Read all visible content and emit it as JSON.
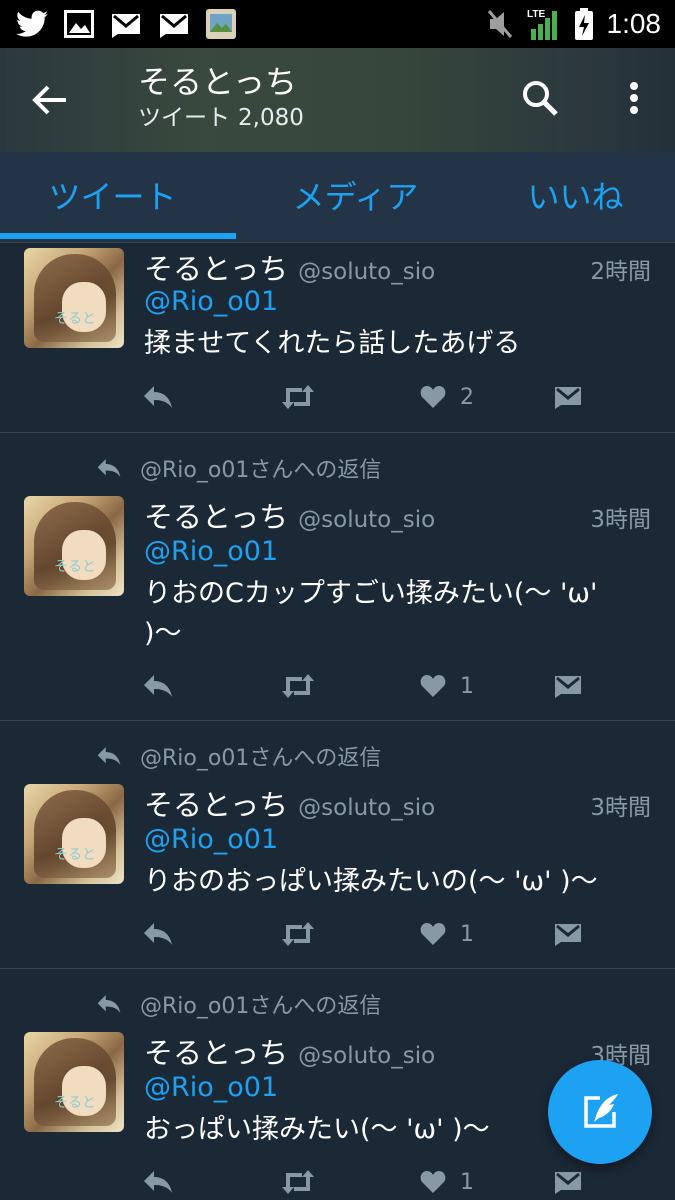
{
  "status_bar": {
    "time": "1:08",
    "network": "LTE",
    "left_icons": [
      "twitter-icon",
      "image-icon",
      "mail-icon",
      "mail-icon",
      "gallery-icon"
    ],
    "right_icons": [
      "mute-icon",
      "signal-icon",
      "battery-charging-icon"
    ]
  },
  "header": {
    "title": "そるとっち",
    "tweet_count_label": "ツイート",
    "tweet_count": "2,080"
  },
  "tabs": [
    {
      "label": "ツイート",
      "active": true
    },
    {
      "label": "メディア",
      "active": false
    },
    {
      "label": "いいね",
      "active": false
    }
  ],
  "tweets": [
    {
      "reply_context": "",
      "name": "そるとっち",
      "handle": "@soluto_sio",
      "time": "2時間",
      "mention": "@Rio_o01",
      "text": "揉ませてくれたら話したあげる",
      "likes": "2"
    },
    {
      "reply_context": "@Rio_o01さんへの返信",
      "name": "そるとっち",
      "handle": "@soluto_sio",
      "time": "3時間",
      "mention": "@Rio_o01",
      "text_line1": "りおのCカップすごい揉みたい(〜 'ω'",
      "text_line2": ")〜",
      "likes": "1"
    },
    {
      "reply_context": "@Rio_o01さんへの返信",
      "name": "そるとっち",
      "handle": "@soluto_sio",
      "time": "3時間",
      "mention": "@Rio_o01",
      "text": "りおのおっぱい揉みたいの(〜 'ω' )〜",
      "likes": "1"
    },
    {
      "reply_context": "@Rio_o01さんへの返信",
      "name": "そるとっち",
      "handle": "@soluto_sio",
      "time": "3時間",
      "mention": "@Rio_o01",
      "text": "おっぱい揉みたい(〜 'ω' )〜",
      "likes": "1"
    }
  ],
  "avatar_text": "そると",
  "colors": {
    "accent": "#1da1f2",
    "background": "#1b2836",
    "secondary_text": "#8899a6"
  }
}
